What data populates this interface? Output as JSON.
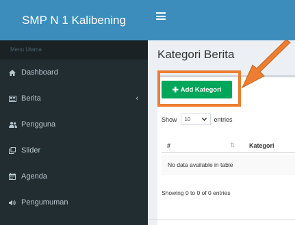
{
  "app": {
    "brand": "SMP N 1 Kalibening"
  },
  "sidebar": {
    "header": "Menu Utama",
    "items": [
      {
        "label": "Dashboard",
        "icon": "home-icon"
      },
      {
        "label": "Berita",
        "icon": "newspaper-icon",
        "has_submenu": true
      },
      {
        "label": "Pengguna",
        "icon": "users-icon"
      },
      {
        "label": "Slider",
        "icon": "clone-icon"
      },
      {
        "label": "Agenda",
        "icon": "calendar-icon"
      },
      {
        "label": "Pengumuman",
        "icon": "volume-icon"
      }
    ]
  },
  "main": {
    "title": "Kategori Berita",
    "add_button": "Add Kategori",
    "length_prefix": "Show",
    "length_value": "10",
    "length_suffix": "entries",
    "columns": [
      "#",
      "Kategori"
    ],
    "empty_text": "No data available in table",
    "info_text": "Showing 0 to 0 of 0 entries"
  },
  "colors": {
    "header": "#3c8dbc",
    "sidebar": "#222d32",
    "button": "#00a65a",
    "annotation": "#ed7d31"
  }
}
